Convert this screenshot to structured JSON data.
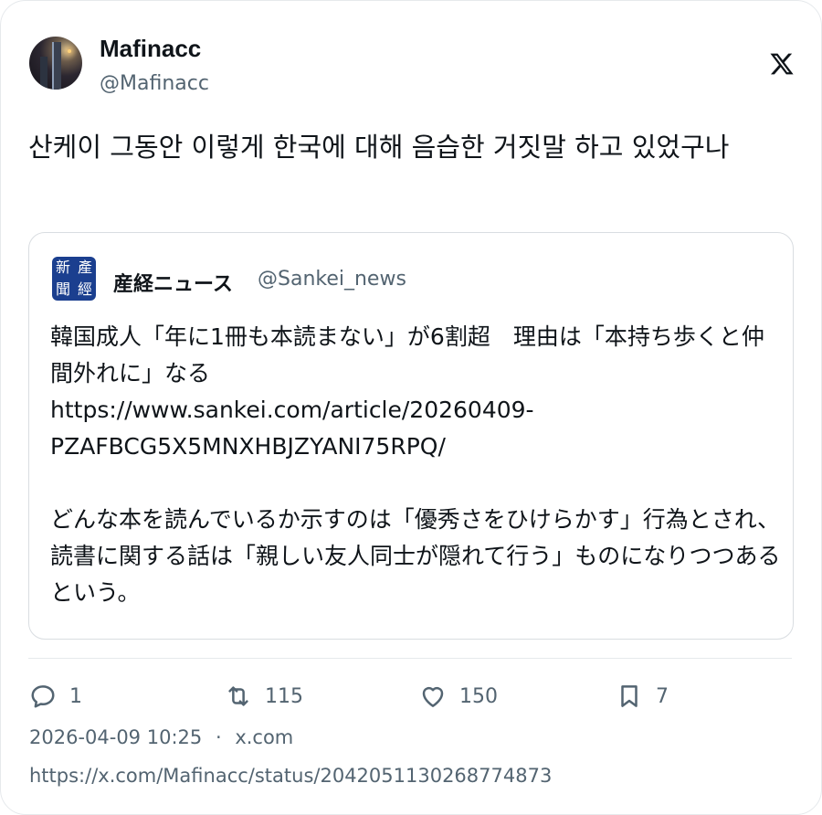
{
  "author": {
    "name": "Mafinacc",
    "handle": "@Mafinacc"
  },
  "tweet": {
    "text": "산케이 그동안 이렇게 한국에 대해 음습한 거짓말 하고 있었구나"
  },
  "quoted": {
    "logo_chars": [
      "產",
      "經",
      "新",
      "聞"
    ],
    "name": "産経ニュース",
    "handle": "@Sankei_news",
    "body": "韓国成人「年に1冊も本読まない」が6割超　理由は「本持ち歩くと仲間外れに」なる\nhttps://www.sankei.com/article/20260409-PZAFBCG5X5MNXHBJZYANI75RPQ/\n\nどんな本を読んでいるか示すのは「優秀さをひけらかす」行為とされ、読書に関する話は「親しい友人同士が隠れて行う」ものになりつつあるという。"
  },
  "actions": {
    "reply_count": "1",
    "retweet_count": "115",
    "like_count": "150",
    "bookmark_count": "7"
  },
  "meta": {
    "timestamp": "2026-04-09 10:25",
    "separator": "·",
    "source": "x.com",
    "url": "https://x.com/Mafinacc/status/2042051130268774873"
  },
  "colors": {
    "text": "#0f1419",
    "secondary": "#536471",
    "border": "#d9dde1",
    "sankei_blue": "#1b3f8f"
  },
  "icons": {
    "brand": "x-logo-icon",
    "reply": "speech-bubble-icon",
    "retweet": "retweet-arrows-icon",
    "like": "heart-icon",
    "bookmark": "bookmark-icon"
  }
}
